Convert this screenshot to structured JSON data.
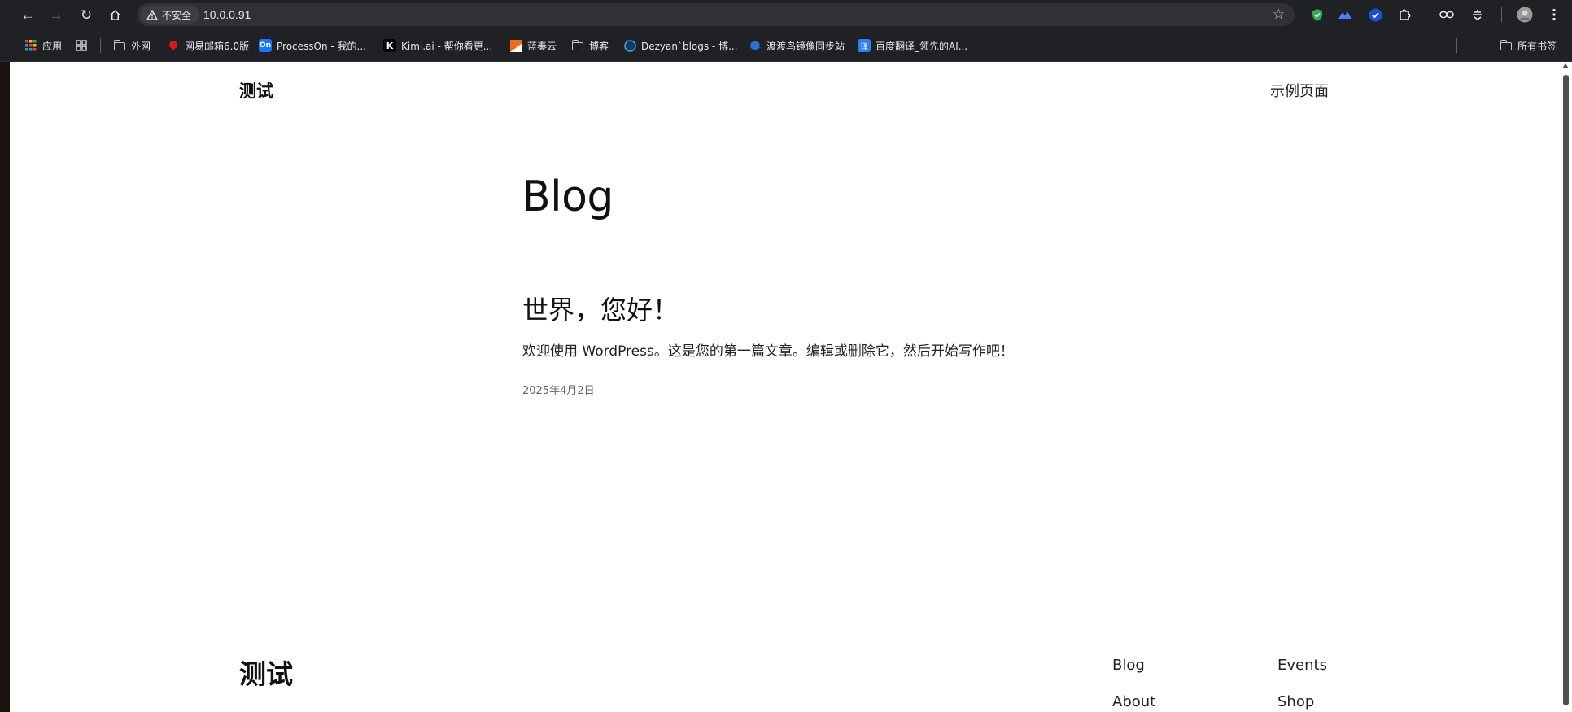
{
  "browser": {
    "security_label": "不安全",
    "url": "10.0.0.91",
    "bookmarks": [
      {
        "label": "应用",
        "icon": "apps-grid-icon"
      },
      {
        "label": "",
        "icon": "tab-groups-icon"
      },
      {
        "label": "外网",
        "icon": "folder-icon"
      },
      {
        "label": "网易邮箱6.0版",
        "icon": "netease-mail-icon"
      },
      {
        "label": "ProcessOn - 我的...",
        "icon": "processon-icon"
      },
      {
        "label": "Kimi.ai - 帮你看更...",
        "icon": "kimi-icon"
      },
      {
        "label": "蓝奏云",
        "icon": "lanzou-icon"
      },
      {
        "label": "博客",
        "icon": "folder-icon"
      },
      {
        "label": "Dezyan`blogs - 博...",
        "icon": "dezyan-blog-icon"
      },
      {
        "label": "渡渡鸟镜像同步站",
        "icon": "dodo-mirror-icon"
      },
      {
        "label": "百度翻译_领先的AI...",
        "icon": "baidu-translate-icon"
      }
    ],
    "all_bookmarks_label": "所有书签"
  },
  "site": {
    "title": "测试",
    "nav_item": "示例页面"
  },
  "main": {
    "heading": "Blog",
    "post": {
      "title": "世界，您好！",
      "excerpt": "欢迎使用 WordPress。这是您的第一篇文章。编辑或删除它，然后开始写作吧！",
      "date": "2025年4月2日"
    }
  },
  "footer": {
    "title": "测试",
    "links": [
      "Blog",
      "Events",
      "About",
      "Shop"
    ]
  }
}
